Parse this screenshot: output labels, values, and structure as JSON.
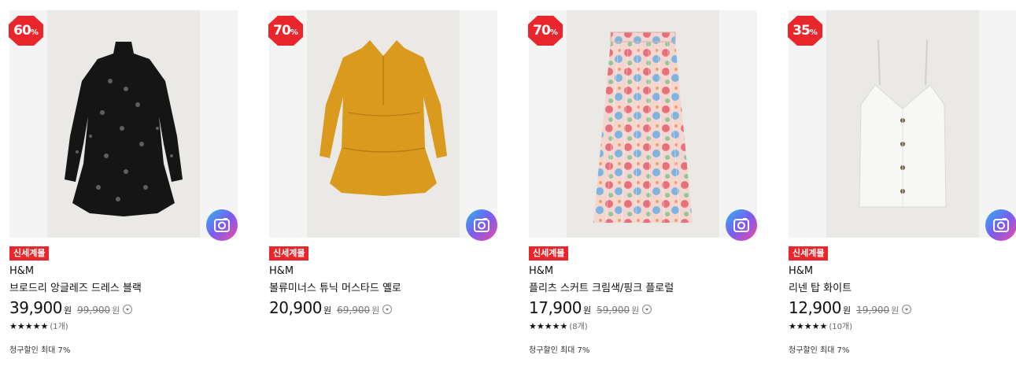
{
  "products": [
    {
      "discount_rate": "60",
      "discount_unit": "%",
      "tag": "신세계몰",
      "brand": "H&M",
      "title": "브로드리 앙글레즈 드레스 블랙",
      "price": "39,900",
      "price_unit": "원",
      "original_price": "99,900",
      "original_unit": "원",
      "stars": "★★★★★",
      "review_count": "(1개)",
      "card_discount": "청구할인 최대 7%",
      "garment_color": "#151515",
      "garment": "dress-black"
    },
    {
      "discount_rate": "70",
      "discount_unit": "%",
      "tag": "신세계몰",
      "brand": "H&M",
      "title": "볼류미너스 튜닉 머스타드 옐로",
      "price": "20,900",
      "price_unit": "원",
      "original_price": "69,900",
      "original_unit": "원",
      "stars": "",
      "review_count": "",
      "card_discount": "",
      "garment_color": "#d99a1e",
      "garment": "tunic-mustard"
    },
    {
      "discount_rate": "70",
      "discount_unit": "%",
      "tag": "신세계몰",
      "brand": "H&M",
      "title": "플리츠 스커트 크림색/핑크 플로럴",
      "price": "17,900",
      "price_unit": "원",
      "original_price": "59,900",
      "original_unit": "원",
      "stars": "★★★★★",
      "review_count": "(8개)",
      "card_discount": "청구할인 최대 7%",
      "garment_color": "#e8a0a0",
      "garment": "skirt-floral"
    },
    {
      "discount_rate": "35",
      "discount_unit": "%",
      "tag": "신세계몰",
      "brand": "H&M",
      "title": "리넨 탑 화이트",
      "price": "12,900",
      "price_unit": "원",
      "original_price": "19,900",
      "original_unit": "원",
      "stars": "★★★★★",
      "review_count": "(10개)",
      "card_discount": "청구할인 최대 7%",
      "garment_color": "#f7f7f5",
      "garment": "top-white"
    }
  ],
  "colors": {
    "badge_red": "#e8262b",
    "tag_red": "#e8262b",
    "camera_gradient": [
      "#2bb6f0",
      "#7a5cf0",
      "#f04ba0"
    ]
  },
  "icons": {
    "badge": "discount-badge-octagon",
    "camera": "camera-icon",
    "info": "chevron-down-circle-icon"
  }
}
